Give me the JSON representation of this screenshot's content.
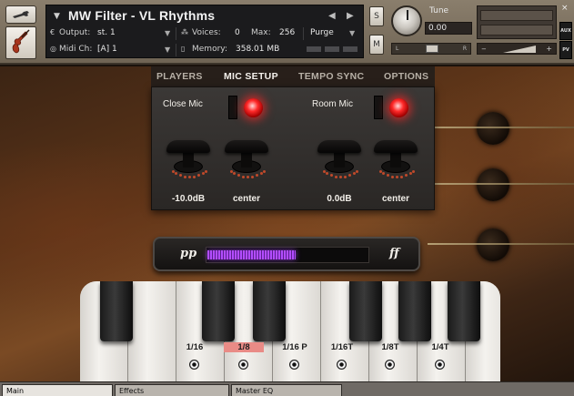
{
  "header": {
    "instrument_title": "MW Filter - VL Rhythms",
    "output_label": "Output:",
    "output_value": "st. 1",
    "voices_label": "Voices:",
    "voices_value": "0",
    "max_label": "Max:",
    "max_value": "256",
    "purge_label": "Purge",
    "midi_label": "Midi Ch:",
    "midi_value": "[A]  1",
    "memory_label": "Memory:",
    "memory_value": "358.01 MB",
    "solo_label": "S",
    "mute_label": "M",
    "tune_label": "Tune",
    "tune_value": "0.00",
    "pan_left": "L",
    "pan_right": "R",
    "aux_label": "AUX",
    "pv_label": "PV",
    "close_glyph": "×"
  },
  "tabs": [
    {
      "label": "PLAYERS",
      "active": false
    },
    {
      "label": "MIC SETUP",
      "active": true
    },
    {
      "label": "TEMPO SYNC",
      "active": false
    },
    {
      "label": "OPTIONS",
      "active": false
    }
  ],
  "mics": [
    {
      "label": "Close Mic",
      "on": true,
      "level": "-10.0dB",
      "pan": "center"
    },
    {
      "label": "Room Mic",
      "on": true,
      "level": "0.0dB",
      "pan": "center"
    }
  ],
  "dynamics": {
    "left_mark": "pp",
    "right_mark": "ff",
    "level_fraction": 0.55,
    "fill_color": "#b24dff"
  },
  "rates": [
    {
      "label": "1/16",
      "selected": false
    },
    {
      "label": "1/8",
      "selected": true
    },
    {
      "label": "1/16 P",
      "selected": false
    },
    {
      "label": "1/16T",
      "selected": false
    },
    {
      "label": "1/8T",
      "selected": false
    },
    {
      "label": "1/4T",
      "selected": false
    }
  ],
  "bottom_tabs": [
    {
      "label": "Main",
      "active": true
    },
    {
      "label": "Effects",
      "active": false
    },
    {
      "label": "Master EQ",
      "active": false
    }
  ],
  "icons": {
    "tool": "wrench-icon",
    "instrument": "violin-icon",
    "mic_on": "led-on-icon"
  },
  "colors": {
    "led_red": "#ff2a2a",
    "selected_rate": "#e98b86",
    "panel_dark": "#2a2725"
  }
}
